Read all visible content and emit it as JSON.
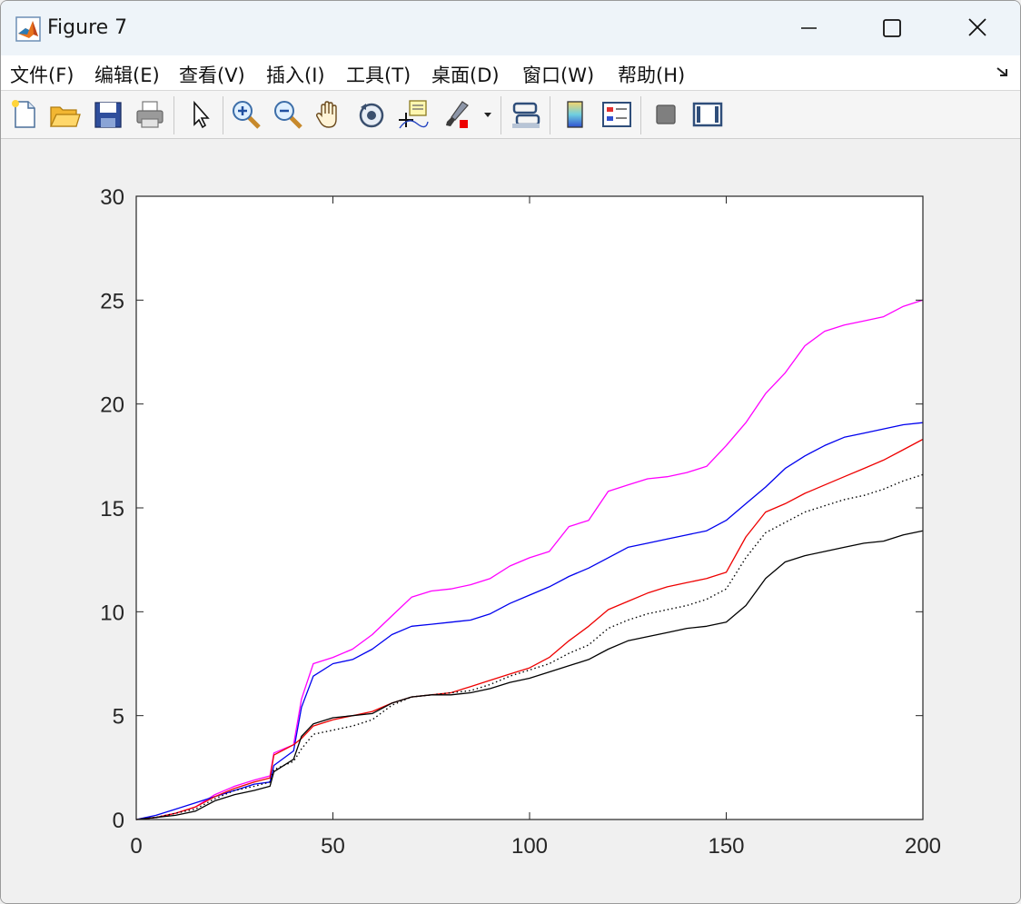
{
  "window": {
    "title": "Figure 7",
    "icon": "matlab-logo-icon",
    "controls": [
      "minimize-icon",
      "maximize-icon",
      "close-icon"
    ]
  },
  "menu": {
    "items": [
      {
        "label": "文件(F)"
      },
      {
        "label": "编辑(E)"
      },
      {
        "label": "查看(V)"
      },
      {
        "label": "插入(I)"
      },
      {
        "label": "工具(T)"
      },
      {
        "label": "桌面(D)"
      },
      {
        "label": "窗口(W)"
      },
      {
        "label": "帮助(H)"
      }
    ],
    "corner_icon": "dock-arrow-icon"
  },
  "toolbar": {
    "buttons": [
      "new-figure-icon",
      "open-file-icon",
      "save-icon",
      "print-icon",
      "select-arrow-icon",
      "zoom-in-icon",
      "zoom-out-icon",
      "pan-hand-icon",
      "rotate-3d-icon",
      "data-cursor-icon",
      "brush-icon",
      "link-plot-icon",
      "colorbar-icon",
      "legend-icon",
      "hide-plot-tools-icon",
      "show-plot-tools-icon"
    ]
  },
  "chart_data": {
    "type": "line",
    "title": "",
    "xlabel": "",
    "ylabel": "",
    "xlim": [
      0,
      200
    ],
    "ylim": [
      0,
      30
    ],
    "xticks": [
      0,
      50,
      100,
      150,
      200
    ],
    "yticks": [
      0,
      5,
      10,
      15,
      20,
      25,
      30
    ],
    "grid": false,
    "legend": "none",
    "x": [
      0,
      5,
      10,
      15,
      20,
      25,
      30,
      34,
      35,
      40,
      42,
      45,
      50,
      55,
      60,
      65,
      70,
      75,
      80,
      85,
      90,
      95,
      100,
      105,
      110,
      115,
      120,
      125,
      130,
      135,
      140,
      145,
      150,
      155,
      160,
      165,
      170,
      175,
      180,
      185,
      190,
      195,
      200
    ],
    "series": [
      {
        "color": "#ff00ff",
        "style": "solid",
        "values": [
          0,
          0.1,
          0.3,
          0.6,
          1.2,
          1.6,
          1.9,
          2.1,
          3.2,
          3.6,
          5.8,
          7.5,
          7.8,
          8.2,
          8.9,
          9.8,
          10.7,
          11.0,
          11.1,
          11.3,
          11.6,
          12.2,
          12.6,
          12.9,
          14.1,
          14.4,
          15.8,
          16.1,
          16.4,
          16.5,
          16.7,
          17.0,
          18.0,
          19.1,
          20.5,
          21.5,
          22.8,
          23.5,
          23.8,
          24.0,
          24.2,
          24.7,
          25.0
        ]
      },
      {
        "color": "#0000ee",
        "style": "solid",
        "values": [
          0,
          0.2,
          0.5,
          0.8,
          1.1,
          1.4,
          1.7,
          1.8,
          2.6,
          3.3,
          5.4,
          6.9,
          7.5,
          7.7,
          8.2,
          8.9,
          9.3,
          9.4,
          9.5,
          9.6,
          9.9,
          10.4,
          10.8,
          11.2,
          11.7,
          12.1,
          12.6,
          13.1,
          13.3,
          13.5,
          13.7,
          13.9,
          14.4,
          15.2,
          16.0,
          16.9,
          17.5,
          18.0,
          18.4,
          18.6,
          18.8,
          19.0,
          19.1
        ]
      },
      {
        "color": "#ee0000",
        "style": "solid",
        "values": [
          0,
          0.1,
          0.3,
          0.6,
          1.1,
          1.5,
          1.8,
          2.0,
          3.1,
          3.6,
          3.9,
          4.5,
          4.8,
          5.0,
          5.2,
          5.6,
          5.9,
          6.0,
          6.1,
          6.4,
          6.7,
          7.0,
          7.3,
          7.8,
          8.6,
          9.3,
          10.1,
          10.5,
          10.9,
          11.2,
          11.4,
          11.6,
          11.9,
          13.6,
          14.8,
          15.2,
          15.7,
          16.1,
          16.5,
          16.9,
          17.3,
          17.8,
          18.3
        ]
      },
      {
        "color": "#000000",
        "style": "dotted",
        "values": [
          0,
          0.1,
          0.3,
          0.5,
          1.0,
          1.4,
          1.6,
          1.8,
          2.4,
          2.8,
          3.4,
          4.1,
          4.3,
          4.5,
          4.8,
          5.5,
          5.9,
          6.0,
          6.1,
          6.2,
          6.5,
          6.9,
          7.2,
          7.5,
          8.0,
          8.4,
          9.2,
          9.6,
          9.9,
          10.1,
          10.3,
          10.6,
          11.1,
          12.6,
          13.8,
          14.3,
          14.8,
          15.1,
          15.4,
          15.6,
          15.9,
          16.3,
          16.6
        ]
      },
      {
        "color": "#000000",
        "style": "solid",
        "values": [
          0,
          0.1,
          0.2,
          0.4,
          0.9,
          1.2,
          1.4,
          1.6,
          2.3,
          2.9,
          4.0,
          4.6,
          4.9,
          5.0,
          5.1,
          5.6,
          5.9,
          6.0,
          6.0,
          6.1,
          6.3,
          6.6,
          6.8,
          7.1,
          7.4,
          7.7,
          8.2,
          8.6,
          8.8,
          9.0,
          9.2,
          9.3,
          9.5,
          10.3,
          11.6,
          12.4,
          12.7,
          12.9,
          13.1,
          13.3,
          13.4,
          13.7,
          13.9
        ]
      }
    ]
  }
}
